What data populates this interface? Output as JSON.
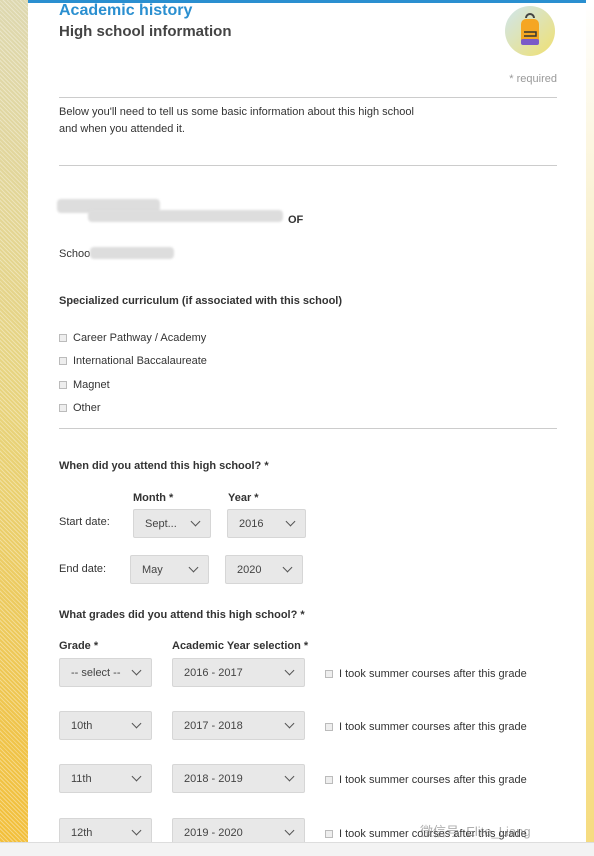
{
  "header": {
    "section": "Academic history",
    "title": "High school information",
    "avatar_icon": "backpack-icon",
    "required_note": "* required"
  },
  "intro": {
    "line1": "Below you'll need to tell us some basic information about this high school",
    "line2": "and when you attended it."
  },
  "school": {
    "address_suffix": "OF",
    "school_label_prefix": "Schoo"
  },
  "curriculum": {
    "label": "Specialized curriculum (if associated with this school)",
    "options": [
      "Career Pathway / Academy",
      "International Baccalaureate",
      "Magnet",
      "Other"
    ]
  },
  "attendance": {
    "question": "When did you attend this high school? *",
    "month_label": "Month *",
    "year_label": "Year *",
    "start_label": "Start date:",
    "end_label": "End date:",
    "start_month": "Sept...",
    "start_year": "2016",
    "end_month": "May",
    "end_year": "2020"
  },
  "grades": {
    "question": "What grades did you attend this high school? *",
    "grade_label": "Grade *",
    "year_label": "Academic Year selection *",
    "summer_label": "I took summer courses after this grade",
    "rows": [
      {
        "grade": "-- select --",
        "year": "2016 - 2017"
      },
      {
        "grade": "10th",
        "year": "2017 - 2018"
      },
      {
        "grade": "11th",
        "year": "2018 - 2019"
      },
      {
        "grade": "12th",
        "year": "2019 - 2020"
      }
    ]
  },
  "watermark": "微信号: Elite_Liang",
  "colors": {
    "accent": "#2a8fd0"
  }
}
